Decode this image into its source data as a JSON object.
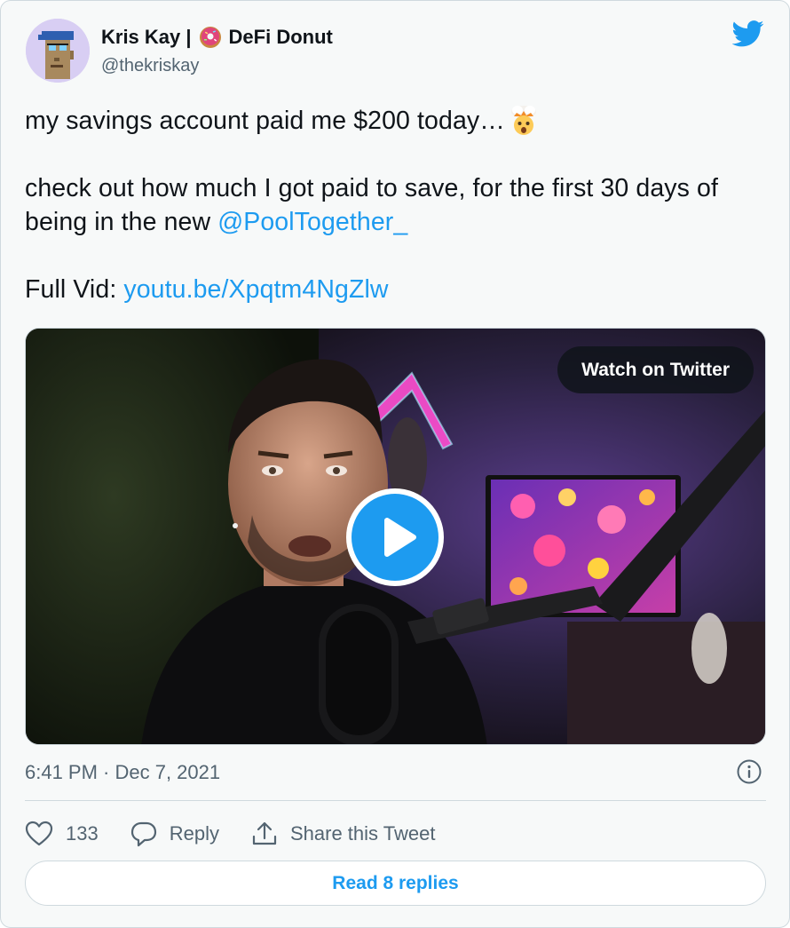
{
  "author": {
    "name_prefix": "Kris Kay |",
    "name_suffix": "DeFi Donut",
    "handle": "@thekriskay",
    "avatar_icon": "pixel-punk-avatar",
    "name_emoji_icon": "donut-icon"
  },
  "platform_icon": "twitter-bird-icon",
  "tweet": {
    "line1": "my savings account paid me $200 today…",
    "line1_emoji": "exploding-head-emoji",
    "line2_text": "check out how much I got paid to save, for the first 30 days of being in the new ",
    "line2_mention": "@PoolTogether_",
    "line3_label": "Full Vid: ",
    "line3_link": "youtu.be/Xpqtm4NgZlw"
  },
  "media": {
    "watch_label": "Watch on Twitter",
    "play_icon": "play-icon"
  },
  "meta": {
    "timestamp": "6:41 PM · Dec 7, 2021",
    "info_icon": "info-icon"
  },
  "actions": {
    "like_count": "133",
    "reply_label": "Reply",
    "share_label": "Share this Tweet"
  },
  "footer": {
    "read_replies_label": "Read 8 replies"
  },
  "colors": {
    "accent": "#1d9bf0",
    "text_primary": "#0f1419",
    "text_secondary": "#536471",
    "border": "#cfd9de"
  }
}
